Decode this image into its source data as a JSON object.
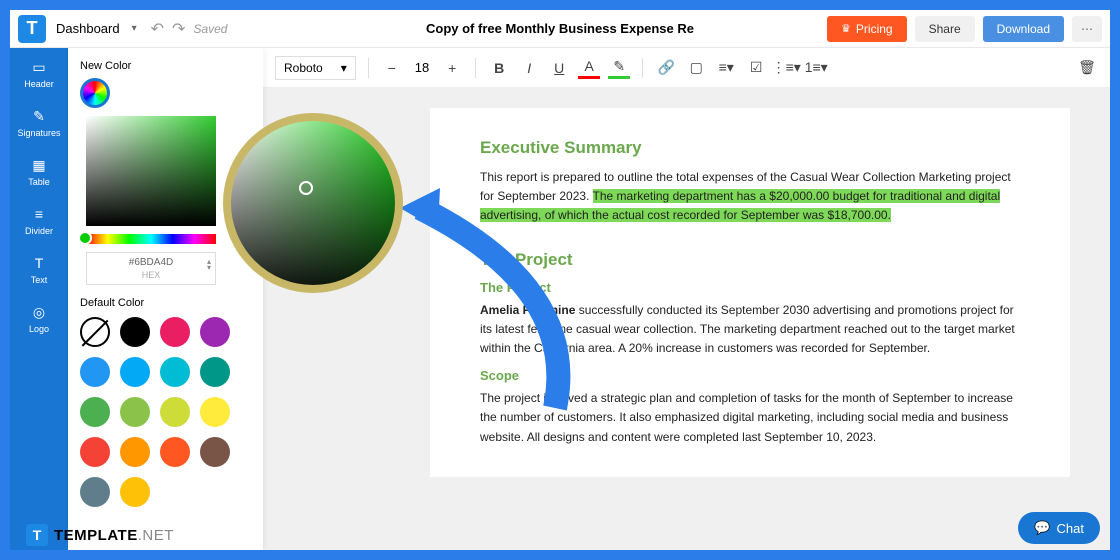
{
  "topbar": {
    "dashboard": "Dashboard",
    "saved": "Saved",
    "title": "Copy of free Monthly Business Expense Re",
    "pricing": "Pricing",
    "share": "Share",
    "download": "Download"
  },
  "sidebar": {
    "items": [
      {
        "label": "Header"
      },
      {
        "label": "Signatures"
      },
      {
        "label": "Table"
      },
      {
        "label": "Divider"
      },
      {
        "label": "Text"
      },
      {
        "label": "Logo"
      }
    ]
  },
  "colorPanel": {
    "newColor": "New Color",
    "hex": "#6BDA4D",
    "hexLabel": "HEX",
    "defaultColor": "Default Color",
    "swatches": [
      "none",
      "#000000",
      "#e91e63",
      "#9c27b0",
      "#2196f3",
      "#03a9f4",
      "#00bcd4",
      "#009688",
      "#4caf50",
      "#8bc34a",
      "#cddc39",
      "#ffeb3b",
      "#f44336",
      "#ff9800",
      "#ff5722",
      "#795548",
      "#607d8b",
      "#ffc107"
    ]
  },
  "toolbar": {
    "font": "Roboto",
    "size": "18"
  },
  "doc": {
    "h1": "Executive Summary",
    "p1a": "This report is prepared to outline the total expenses of the Casual Wear Collection Marketing project for September 2023. ",
    "p1b": "The marketing department has a $20,000.00 budget for traditional and digital advertising, of which the actual cost recorded for September was $18,700.00.",
    "h2": "The Project",
    "h3a": "The Project",
    "p2": " successfully conducted its September 2030 advertising and promotions project for its latest feminine casual wear collection. The marketing department reached out to the target market within the California area. A 20% increase in customers was recorded for September.",
    "p2b": "Amelia Feminine",
    "h3b": "Scope",
    "p3": "The project involved a strategic plan and completion of tasks for the month of September to increase the number of customers. It also emphasized digital marketing, including social media and business website. All designs and content were completed last September 10, 2023."
  },
  "chat": "Chat",
  "brand": {
    "a": "TEMPLATE",
    "b": ".NET"
  }
}
